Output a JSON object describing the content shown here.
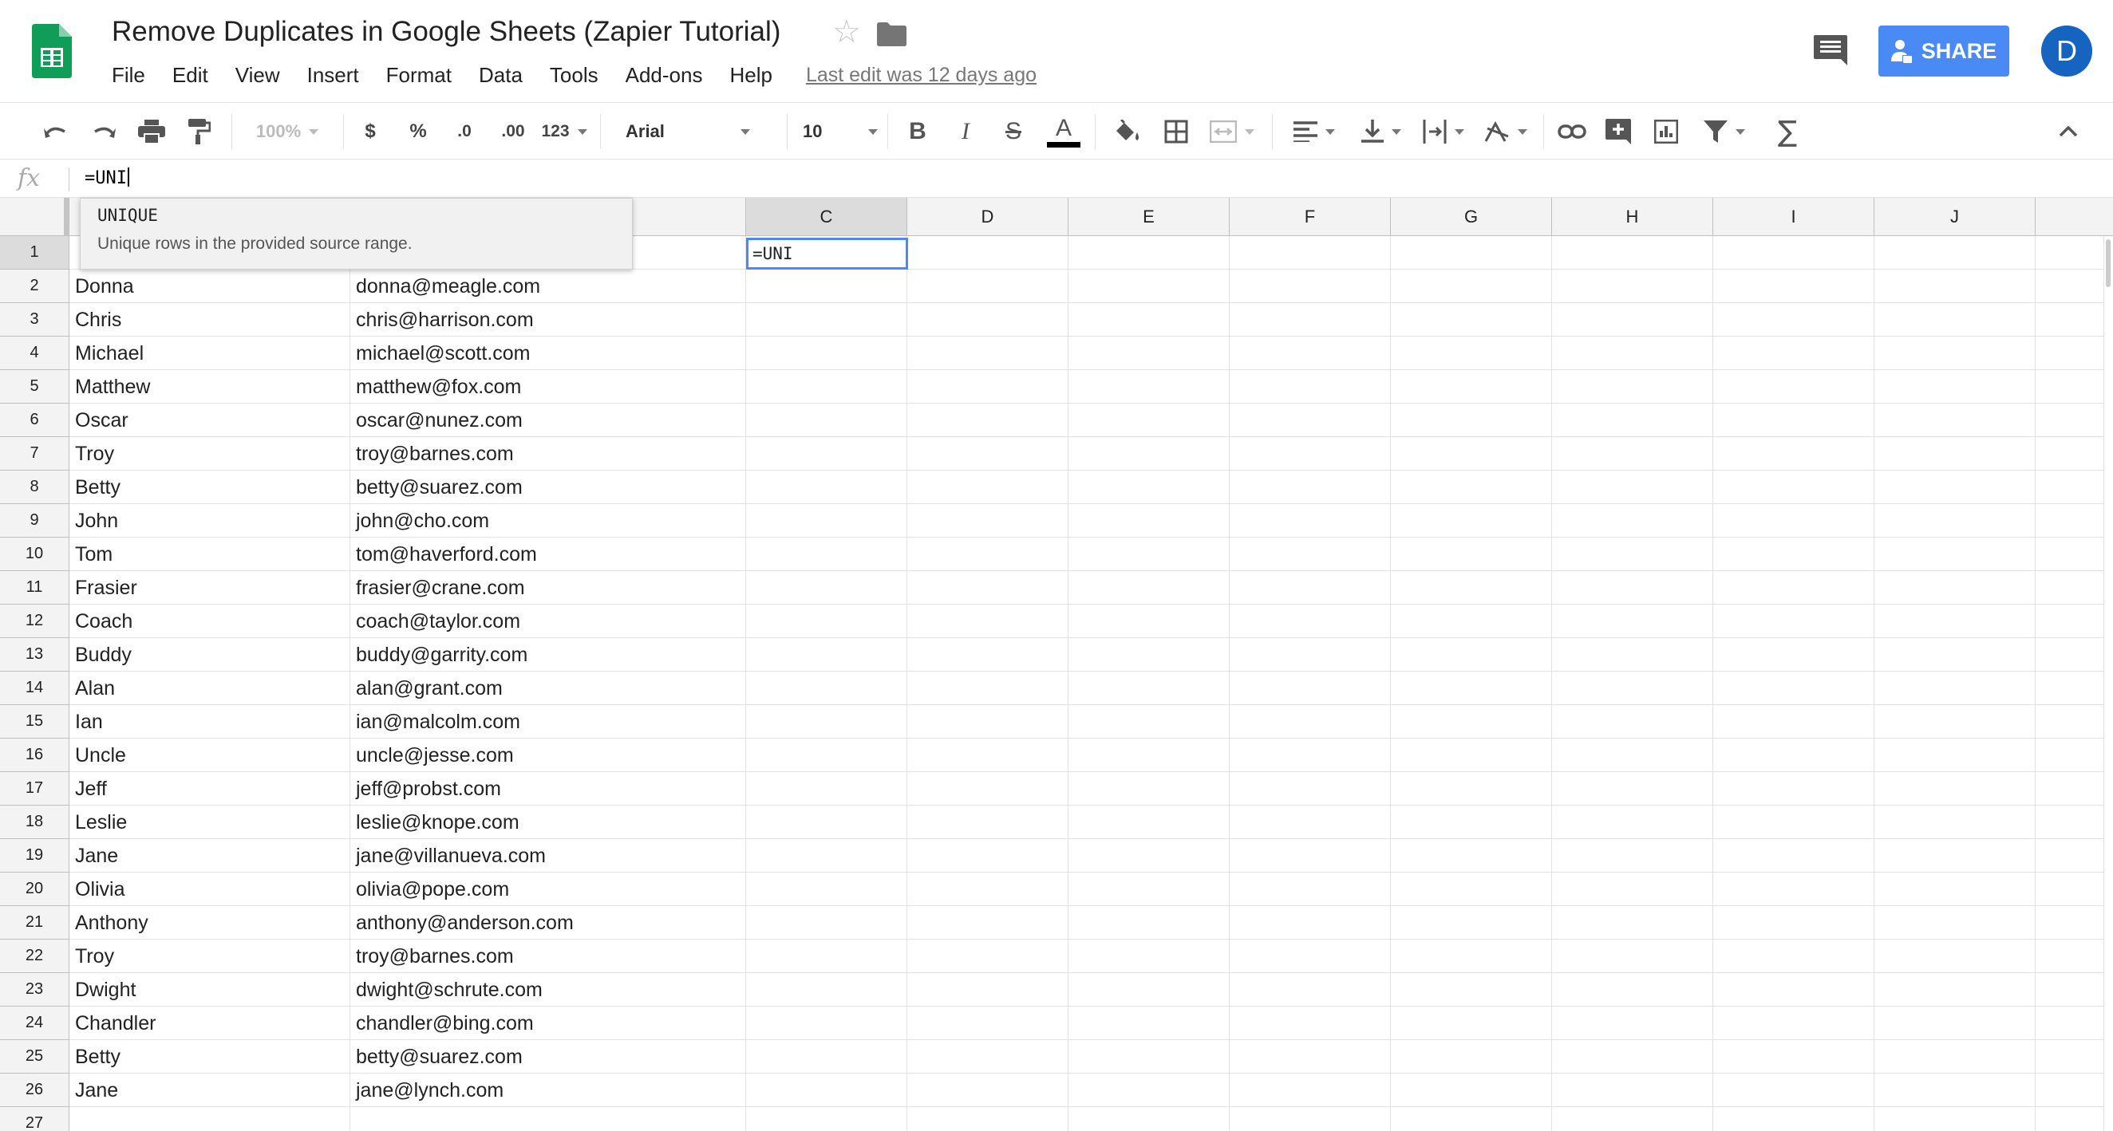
{
  "app": {
    "title": "Remove Duplicates in Google Sheets (Zapier Tutorial)",
    "menus": [
      "File",
      "Edit",
      "View",
      "Insert",
      "Format",
      "Data",
      "Tools",
      "Add-ons",
      "Help"
    ],
    "last_edit": "Last edit was 12 days ago",
    "share_label": "SHARE",
    "avatar_letter": "D",
    "brand_color": "#4a8af4"
  },
  "toolbar": {
    "zoom": "100%",
    "currency": "$",
    "percent": "%",
    "decrease_decimals": ".0",
    "increase_decimals": ".00",
    "more_formats": "123",
    "font": "Arial",
    "font_size": "10",
    "bold": "B",
    "italic": "I",
    "strikethrough": "S",
    "text_color": "A"
  },
  "formula_bar": {
    "fx": "fx",
    "value": "=UNI"
  },
  "autocomplete": {
    "function": "UNIQUE",
    "description": "Unique rows in the provided source range."
  },
  "columns": [
    "C",
    "D",
    "E",
    "F",
    "G",
    "H",
    "I",
    "J"
  ],
  "active_cell": {
    "ref": "C1",
    "value": "=UNI"
  },
  "rows": [
    {
      "n": "1",
      "a": "",
      "b": ""
    },
    {
      "n": "2",
      "a": "Donna",
      "b": "donna@meagle.com"
    },
    {
      "n": "3",
      "a": "Chris",
      "b": "chris@harrison.com"
    },
    {
      "n": "4",
      "a": "Michael",
      "b": "michael@scott.com"
    },
    {
      "n": "5",
      "a": "Matthew",
      "b": "matthew@fox.com"
    },
    {
      "n": "6",
      "a": "Oscar",
      "b": "oscar@nunez.com"
    },
    {
      "n": "7",
      "a": "Troy",
      "b": "troy@barnes.com"
    },
    {
      "n": "8",
      "a": "Betty",
      "b": "betty@suarez.com"
    },
    {
      "n": "9",
      "a": "John",
      "b": "john@cho.com"
    },
    {
      "n": "10",
      "a": "Tom",
      "b": "tom@haverford.com"
    },
    {
      "n": "11",
      "a": "Frasier",
      "b": "frasier@crane.com"
    },
    {
      "n": "12",
      "a": "Coach",
      "b": "coach@taylor.com"
    },
    {
      "n": "13",
      "a": "Buddy",
      "b": "buddy@garrity.com"
    },
    {
      "n": "14",
      "a": "Alan",
      "b": "alan@grant.com"
    },
    {
      "n": "15",
      "a": "Ian",
      "b": "ian@malcolm.com"
    },
    {
      "n": "16",
      "a": "Uncle",
      "b": "uncle@jesse.com"
    },
    {
      "n": "17",
      "a": "Jeff",
      "b": "jeff@probst.com"
    },
    {
      "n": "18",
      "a": "Leslie",
      "b": "leslie@knope.com"
    },
    {
      "n": "19",
      "a": "Jane",
      "b": "jane@villanueva.com"
    },
    {
      "n": "20",
      "a": "Olivia",
      "b": "olivia@pope.com"
    },
    {
      "n": "21",
      "a": "Anthony",
      "b": "anthony@anderson.com"
    },
    {
      "n": "22",
      "a": "Troy",
      "b": "troy@barnes.com"
    },
    {
      "n": "23",
      "a": "Dwight",
      "b": "dwight@schrute.com"
    },
    {
      "n": "24",
      "a": "Chandler",
      "b": "chandler@bing.com"
    },
    {
      "n": "25",
      "a": "Betty",
      "b": "betty@suarez.com"
    },
    {
      "n": "26",
      "a": "Jane",
      "b": "jane@lynch.com"
    },
    {
      "n": "27",
      "a": "",
      "b": ""
    }
  ]
}
